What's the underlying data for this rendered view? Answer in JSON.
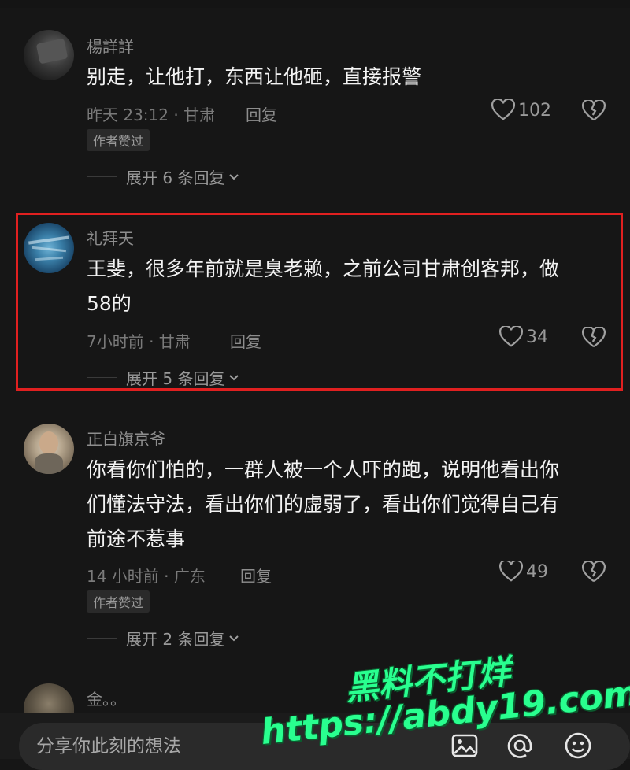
{
  "comments": [
    {
      "username": "楊詳詳",
      "text": "别走，让他打，东西让他砸，直接报警",
      "time_location": "昨天 23:12 · 甘肃",
      "reply_label": "回复",
      "likes": "102",
      "badge": "作者赞过",
      "expand": "展开 6 条回复"
    },
    {
      "username": "礼拜天",
      "text": "王斐，很多年前就是臭老赖，之前公司甘肃创客邦，做\n58的",
      "time_location": "7小时前 · 甘肃",
      "reply_label": "回复",
      "likes": "34",
      "expand": "展开 5 条回复"
    },
    {
      "username": "正白旗京爷",
      "text": "你看你们怕的，一群人被一个人吓的跑，说明他看出你\n们懂法守法，看出你们的虚弱了，看出你们觉得自己有\n前途不惹事",
      "time_location": "14 小时前 · 广东",
      "reply_label": "回复",
      "likes": "49",
      "badge": "作者赞过",
      "expand": "展开 2 条回复"
    },
    {
      "username": "金。。"
    }
  ],
  "input": {
    "placeholder": "分享你此刻的想法"
  },
  "icons": {
    "image": "image-icon",
    "mention": "at-icon",
    "emoji": "emoji-icon",
    "like": "heart-icon",
    "dislike": "broken-heart-icon",
    "chevron": "chevron-down-icon"
  },
  "colors": {
    "highlight": "#e02020",
    "watermark": "#29ff8f"
  },
  "watermark": {
    "line1": "黑料不打烊",
    "line2": "https://abdy19.com"
  }
}
